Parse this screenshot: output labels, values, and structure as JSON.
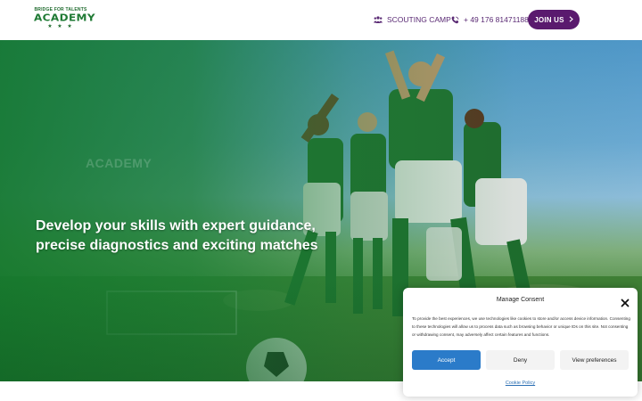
{
  "header": {
    "logo": {
      "top_text": "BRIDGE FOR TALENTS",
      "main_text": "ACADEMY",
      "stars": "★ ★ ★"
    },
    "nav": {
      "scouting": {
        "label": "SCOUTING CAMP",
        "icon": "group-icon"
      },
      "phone": {
        "label": "+ 49 176 81471188",
        "icon": "phone-icon"
      }
    },
    "join_button": {
      "label": "JOIN US",
      "icon": "chevron-right-icon"
    }
  },
  "hero": {
    "headline_line1": "Develop your skills with expert guidance,",
    "headline_line2": "precise diagnostics and exciting matches",
    "watermark": "ACADEMY"
  },
  "consent": {
    "title": "Manage Consent",
    "body": "To provide the best experiences, we use technologies like cookies to store and/or access device information. Consenting to these technologies will allow us to process data such as browsing behavior or unique IDs on this site. Not consenting or withdrawing consent, may adversely affect certain features and functions.",
    "accept_label": "Accept",
    "deny_label": "Deny",
    "preferences_label": "View preferences",
    "policy_link": "Cookie Policy"
  },
  "colors": {
    "brand_purple": "#5a1a6e",
    "brand_green": "#1f7a34",
    "accept_blue": "#2b7bc9"
  }
}
